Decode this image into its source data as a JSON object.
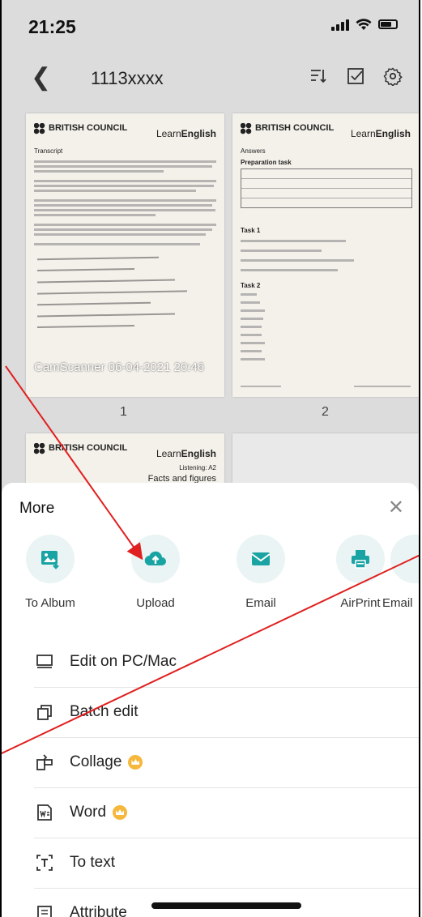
{
  "status_bar": {
    "time": "21:25"
  },
  "nav": {
    "title": "1113xxxx"
  },
  "pages": [
    {
      "number": "1",
      "brand": "BRITISH COUNCIL",
      "product_prefix": "Learn",
      "product_bold": "English",
      "heading": "Transcript",
      "stamp": "CamScanner 06-04-2021 20:46"
    },
    {
      "number": "2",
      "brand": "BRITISH COUNCIL",
      "product_prefix": "Learn",
      "product_bold": "English",
      "heading": "Answers",
      "subheading": "Preparation task",
      "task1": "Task 1",
      "task2": "Task 2"
    },
    {
      "brand": "BRITISH COUNCIL",
      "product_prefix": "Learn",
      "product_bold": "English",
      "level": "Listening: A2",
      "heading": "Facts and figures"
    }
  ],
  "sheet": {
    "title": "More",
    "share_items": [
      {
        "label": "To Album",
        "icon": "album-icon"
      },
      {
        "label": "Upload",
        "icon": "cloud-upload-icon"
      },
      {
        "label": "Email",
        "icon": "email-icon"
      },
      {
        "label": "AirPrint",
        "icon": "printer-icon"
      },
      {
        "label": "Email",
        "icon": "email-icon"
      }
    ],
    "items": [
      {
        "label": "Edit on PC/Mac",
        "icon": "desktop-icon",
        "premium": false
      },
      {
        "label": "Batch edit",
        "icon": "batch-edit-icon",
        "premium": false
      },
      {
        "label": "Collage",
        "icon": "collage-icon",
        "premium": true
      },
      {
        "label": "Word",
        "icon": "word-icon",
        "premium": true
      },
      {
        "label": "To text",
        "icon": "text-recognition-icon",
        "premium": false
      },
      {
        "label": "Attribute",
        "icon": "attribute-icon",
        "premium": false
      }
    ]
  },
  "colors": {
    "accent": "#1aa3a3",
    "annotation": "#e02020",
    "premium": "#f5b83d"
  }
}
